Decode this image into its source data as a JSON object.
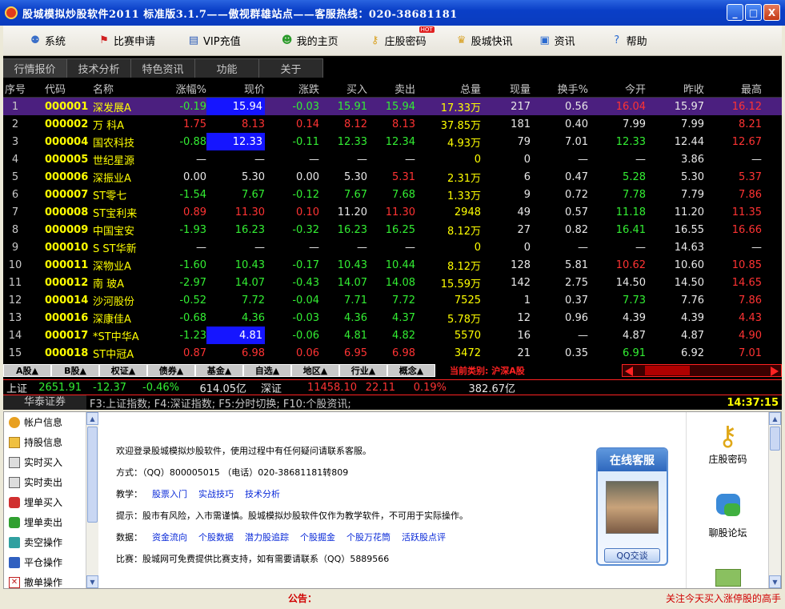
{
  "window": {
    "title": "股城模拟炒股软件2011 标准版3.1.7——傲视群雄站点——客服热线：020-38681181",
    "buttons": [
      "_",
      "□",
      "X"
    ]
  },
  "menu": [
    {
      "label": "系统",
      "icon": "people-icon"
    },
    {
      "label": "比赛申请",
      "icon": "flag-icon"
    },
    {
      "label": "VIP充值",
      "icon": "card-icon"
    },
    {
      "label": "我的主页",
      "icon": "person-icon"
    },
    {
      "label": "庄股密码",
      "icon": "key-icon",
      "badge": "HOT"
    },
    {
      "label": "股城快讯",
      "icon": "trophy-icon"
    },
    {
      "label": "资讯",
      "icon": "window-icon"
    },
    {
      "label": "帮助",
      "icon": "help-icon"
    }
  ],
  "tabs": [
    "行情报价",
    "技术分析",
    "特色资讯",
    "功能",
    "关于"
  ],
  "table": {
    "headers": [
      "序号",
      "代码",
      "名称",
      "涨幅%",
      "现价",
      "涨跌",
      "买入",
      "卖出",
      "总量",
      "现量",
      "换手%",
      "今开",
      "昨收",
      "最高"
    ],
    "rows": [
      {
        "idx": "1",
        "code": "000001",
        "name": "深发展A",
        "chg_pct": "-0.19",
        "price": "15.94",
        "chg": "-0.03",
        "bid": "15.91",
        "ask": "15.94",
        "vol": "17.33万",
        "cur": "217",
        "turn": "0.56",
        "open": "16.04",
        "prev": "15.97",
        "high": "16.12",
        "selected": true,
        "price_hl": true,
        "colors": {
          "chg_pct": "g",
          "price": "w",
          "chg": "g",
          "bid": "g",
          "ask": "g",
          "vol": "y",
          "open": "r",
          "prev": "w",
          "high": "r"
        }
      },
      {
        "idx": "2",
        "code": "000002",
        "name": "万  科A",
        "chg_pct": "1.75",
        "price": "8.13",
        "chg": "0.14",
        "bid": "8.12",
        "ask": "8.13",
        "vol": "37.85万",
        "cur": "181",
        "turn": "0.40",
        "open": "7.99",
        "prev": "7.99",
        "high": "8.21",
        "colors": {
          "chg_pct": "r",
          "price": "r",
          "chg": "r",
          "bid": "r",
          "ask": "r",
          "vol": "y",
          "open": "w",
          "prev": "w",
          "high": "r"
        }
      },
      {
        "idx": "3",
        "code": "000004",
        "name": "国农科技",
        "chg_pct": "-0.88",
        "price": "12.33",
        "chg": "-0.11",
        "bid": "12.33",
        "ask": "12.34",
        "vol": "4.93万",
        "cur": "79",
        "turn": "7.01",
        "open": "12.33",
        "prev": "12.44",
        "high": "12.67",
        "price_hl": true,
        "colors": {
          "chg_pct": "g",
          "price": "w",
          "chg": "g",
          "bid": "g",
          "ask": "g",
          "vol": "y",
          "open": "g",
          "prev": "w",
          "high": "r"
        }
      },
      {
        "idx": "4",
        "code": "000005",
        "name": "世纪星源",
        "chg_pct": "—",
        "price": "—",
        "chg": "—",
        "bid": "—",
        "ask": "—",
        "vol": "0",
        "cur": "0",
        "turn": "—",
        "open": "—",
        "prev": "3.86",
        "high": "—",
        "colors": {
          "chg_pct": "w",
          "price": "w",
          "chg": "w",
          "bid": "w",
          "ask": "w",
          "vol": "y",
          "open": "w",
          "prev": "w",
          "high": "w"
        }
      },
      {
        "idx": "5",
        "code": "000006",
        "name": "深振业A",
        "chg_pct": "0.00",
        "price": "5.30",
        "chg": "0.00",
        "bid": "5.30",
        "ask": "5.31",
        "vol": "2.31万",
        "cur": "6",
        "turn": "0.47",
        "open": "5.28",
        "prev": "5.30",
        "high": "5.37",
        "colors": {
          "chg_pct": "w",
          "price": "w",
          "chg": "w",
          "bid": "w",
          "ask": "r",
          "vol": "y",
          "open": "g",
          "prev": "w",
          "high": "r"
        }
      },
      {
        "idx": "6",
        "code": "000007",
        "name": "ST零七",
        "chg_pct": "-1.54",
        "price": "7.67",
        "chg": "-0.12",
        "bid": "7.67",
        "ask": "7.68",
        "vol": "1.33万",
        "cur": "9",
        "turn": "0.72",
        "open": "7.78",
        "prev": "7.79",
        "high": "7.86",
        "colors": {
          "chg_pct": "g",
          "price": "g",
          "chg": "g",
          "bid": "g",
          "ask": "g",
          "vol": "y",
          "open": "g",
          "prev": "w",
          "high": "r"
        }
      },
      {
        "idx": "7",
        "code": "000008",
        "name": "ST宝利来",
        "chg_pct": "0.89",
        "price": "11.30",
        "chg": "0.10",
        "bid": "11.20",
        "ask": "11.30",
        "vol": "2948",
        "cur": "49",
        "turn": "0.57",
        "open": "11.18",
        "prev": "11.20",
        "high": "11.35",
        "colors": {
          "chg_pct": "r",
          "price": "r",
          "chg": "r",
          "bid": "w",
          "ask": "r",
          "vol": "y",
          "open": "g",
          "prev": "w",
          "high": "r"
        }
      },
      {
        "idx": "8",
        "code": "000009",
        "name": "中国宝安",
        "chg_pct": "-1.93",
        "price": "16.23",
        "chg": "-0.32",
        "bid": "16.23",
        "ask": "16.25",
        "vol": "8.12万",
        "cur": "27",
        "turn": "0.82",
        "open": "16.41",
        "prev": "16.55",
        "high": "16.66",
        "colors": {
          "chg_pct": "g",
          "price": "g",
          "chg": "g",
          "bid": "g",
          "ask": "g",
          "vol": "y",
          "open": "g",
          "prev": "w",
          "high": "r"
        }
      },
      {
        "idx": "9",
        "code": "000010",
        "name": "S ST华新",
        "chg_pct": "—",
        "price": "—",
        "chg": "—",
        "bid": "—",
        "ask": "—",
        "vol": "0",
        "cur": "0",
        "turn": "—",
        "open": "—",
        "prev": "14.63",
        "high": "—",
        "colors": {
          "chg_pct": "w",
          "price": "w",
          "chg": "w",
          "bid": "w",
          "ask": "w",
          "vol": "y",
          "open": "w",
          "prev": "w",
          "high": "w"
        }
      },
      {
        "idx": "10",
        "code": "000011",
        "name": "深物业A",
        "chg_pct": "-1.60",
        "price": "10.43",
        "chg": "-0.17",
        "bid": "10.43",
        "ask": "10.44",
        "vol": "8.12万",
        "cur": "128",
        "turn": "5.81",
        "open": "10.62",
        "prev": "10.60",
        "high": "10.85",
        "colors": {
          "chg_pct": "g",
          "price": "g",
          "chg": "g",
          "bid": "g",
          "ask": "g",
          "vol": "y",
          "open": "r",
          "prev": "w",
          "high": "r"
        }
      },
      {
        "idx": "11",
        "code": "000012",
        "name": "南  玻A",
        "chg_pct": "-2.97",
        "price": "14.07",
        "chg": "-0.43",
        "bid": "14.07",
        "ask": "14.08",
        "vol": "15.59万",
        "cur": "142",
        "turn": "2.75",
        "open": "14.50",
        "prev": "14.50",
        "high": "14.65",
        "colors": {
          "chg_pct": "g",
          "price": "g",
          "chg": "g",
          "bid": "g",
          "ask": "g",
          "vol": "y",
          "open": "w",
          "prev": "w",
          "high": "r"
        }
      },
      {
        "idx": "12",
        "code": "000014",
        "name": "沙河股份",
        "chg_pct": "-0.52",
        "price": "7.72",
        "chg": "-0.04",
        "bid": "7.71",
        "ask": "7.72",
        "vol": "7525",
        "cur": "1",
        "turn": "0.37",
        "open": "7.73",
        "prev": "7.76",
        "high": "7.86",
        "colors": {
          "chg_pct": "g",
          "price": "g",
          "chg": "g",
          "bid": "g",
          "ask": "g",
          "vol": "y",
          "open": "g",
          "prev": "w",
          "high": "r"
        }
      },
      {
        "idx": "13",
        "code": "000016",
        "name": "深康佳A",
        "chg_pct": "-0.68",
        "price": "4.36",
        "chg": "-0.03",
        "bid": "4.36",
        "ask": "4.37",
        "vol": "5.78万",
        "cur": "12",
        "turn": "0.96",
        "open": "4.39",
        "prev": "4.39",
        "high": "4.43",
        "colors": {
          "chg_pct": "g",
          "price": "g",
          "chg": "g",
          "bid": "g",
          "ask": "g",
          "vol": "y",
          "open": "w",
          "prev": "w",
          "high": "r"
        }
      },
      {
        "idx": "14",
        "code": "000017",
        "name": "*ST中华A",
        "chg_pct": "-1.23",
        "price": "4.81",
        "chg": "-0.06",
        "bid": "4.81",
        "ask": "4.82",
        "vol": "5570",
        "cur": "16",
        "turn": "—",
        "open": "4.87",
        "prev": "4.87",
        "high": "4.90",
        "price_hl": true,
        "colors": {
          "chg_pct": "g",
          "price": "w",
          "chg": "g",
          "bid": "g",
          "ask": "g",
          "vol": "y",
          "open": "w",
          "prev": "w",
          "high": "r"
        }
      },
      {
        "idx": "15",
        "code": "000018",
        "name": "ST中冠A",
        "chg_pct": "0.87",
        "price": "6.98",
        "chg": "0.06",
        "bid": "6.95",
        "ask": "6.98",
        "vol": "3472",
        "cur": "21",
        "turn": "0.35",
        "open": "6.91",
        "prev": "6.92",
        "high": "7.01",
        "colors": {
          "chg_pct": "r",
          "price": "r",
          "chg": "r",
          "bid": "r",
          "ask": "r",
          "vol": "y",
          "open": "g",
          "prev": "w",
          "high": "r"
        }
      }
    ]
  },
  "categories": [
    "A股▲",
    "B股▲",
    "权证▲",
    "债券▲",
    "基金▲",
    "自选▲",
    "地区▲",
    "行业▲",
    "概念▲"
  ],
  "current_category": "当前类别: 沪深A股",
  "index": {
    "sh_label": "上证",
    "sh_value": "2651.91",
    "sh_chg": "-12.37",
    "sh_pct": "-0.46%",
    "sh_amount": "614.05亿",
    "sz_label": "深证",
    "sz_value": "11458.10",
    "sz_chg": "22.11",
    "sz_pct": "0.19%",
    "sz_amount": "382.67亿"
  },
  "status": {
    "broker": "华泰证券",
    "hint": "F3:上证指数; F4:深证指数; F5:分时切换; F10:个股资讯;",
    "time": "14:37:15"
  },
  "leftnav": [
    {
      "label": "帐户信息",
      "icon": "gear-icon"
    },
    {
      "label": "持股信息",
      "icon": "folder-icon"
    },
    {
      "label": "实时买入",
      "icon": "buy-icon"
    },
    {
      "label": "实时卖出",
      "icon": "sell-icon"
    },
    {
      "label": "埋单买入",
      "icon": "car-icon"
    },
    {
      "label": "埋单卖出",
      "icon": "car-sell-icon"
    },
    {
      "label": "卖空操作",
      "icon": "network-icon"
    },
    {
      "label": "平仓操作",
      "icon": "cart-icon"
    },
    {
      "label": "撤单操作",
      "icon": "cancel-icon"
    }
  ],
  "welcome": {
    "line1": "欢迎登录股城模拟炒股软件，使用过程中有任何疑问请联系客服。",
    "line2": "方式：（QQ）800005015 （电话）020-38681181转809",
    "teach_label": "教学：",
    "teach_links": [
      "股票入门",
      "实战技巧",
      "技术分析"
    ],
    "tip": "提示：股市有风险，入市需谨慎。股城模拟炒股软件仅作为教学软件，不可用于实际操作。",
    "data_label": "数据：",
    "data_links": [
      "资金流向",
      "个股数据",
      "潜力股追踪",
      "个股掘金",
      "个股万花筒",
      "活跃股点评"
    ],
    "contest": "比赛：股城网可免费提供比赛支持，如有需要请联系（QQ）5889566"
  },
  "kefu": {
    "title": "在线客服",
    "button": "QQ交谈"
  },
  "rightpanel": [
    {
      "label": "庄股密码",
      "icon": "key-icon"
    },
    {
      "label": "聊股论坛",
      "icon": "chat-icon"
    },
    {
      "label": "",
      "icon": "money-icon"
    }
  ],
  "footer": {
    "notice_label": "公告：",
    "marquee": "关注今天买入涨停股的高手"
  }
}
